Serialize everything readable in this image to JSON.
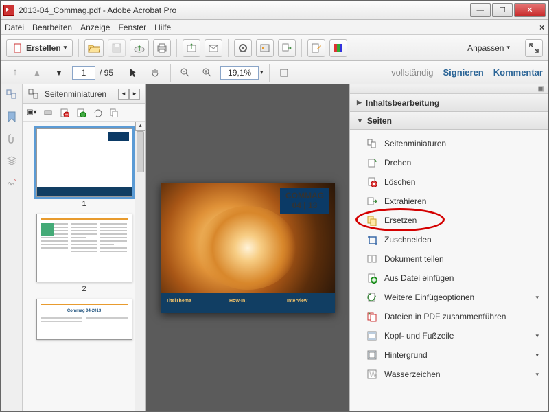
{
  "window": {
    "title": "2013-04_Commag.pdf - Adobe Acrobat Pro"
  },
  "menu": {
    "items": [
      "Datei",
      "Bearbeiten",
      "Anzeige",
      "Fenster",
      "Hilfe"
    ]
  },
  "toolbar": {
    "create": "Erstellen",
    "customize": "Anpassen"
  },
  "pagebar": {
    "current": "1",
    "total": "95",
    "zoom": "19,1%"
  },
  "rightlinks": {
    "full": "vollständig",
    "sign": "Signieren",
    "comment": "Kommentar"
  },
  "thumbs": {
    "title": "Seitenminiaturen",
    "p1": "1",
    "p2": "2"
  },
  "mainpage": {
    "badge1": "COMMAG",
    "badge2": "04 | 13",
    "f1": "TitelThema",
    "f2": "How-In:",
    "f3": "Interview"
  },
  "tools": {
    "section1": "Inhaltsbearbeitung",
    "section2": "Seiten",
    "items": [
      {
        "label": "Seitenminiaturen",
        "icon": "pages"
      },
      {
        "label": "Drehen",
        "icon": "rotate"
      },
      {
        "label": "Löschen",
        "icon": "delete"
      },
      {
        "label": "Extrahieren",
        "icon": "extract"
      },
      {
        "label": "Ersetzen",
        "icon": "replace"
      },
      {
        "label": "Zuschneiden",
        "icon": "crop"
      },
      {
        "label": "Dokument teilen",
        "icon": "split"
      },
      {
        "label": "Aus Datei einfügen",
        "icon": "insertfile"
      },
      {
        "label": "Weitere Einfügeoptionen",
        "icon": "moreinsert",
        "more": true
      },
      {
        "label": "Dateien in PDF zusammenführen",
        "icon": "combine"
      },
      {
        "label": "Kopf- und Fußzeile",
        "icon": "headerfooter",
        "more": true
      },
      {
        "label": "Hintergrund",
        "icon": "background",
        "more": true
      },
      {
        "label": "Wasserzeichen",
        "icon": "watermark",
        "more": true
      }
    ]
  }
}
